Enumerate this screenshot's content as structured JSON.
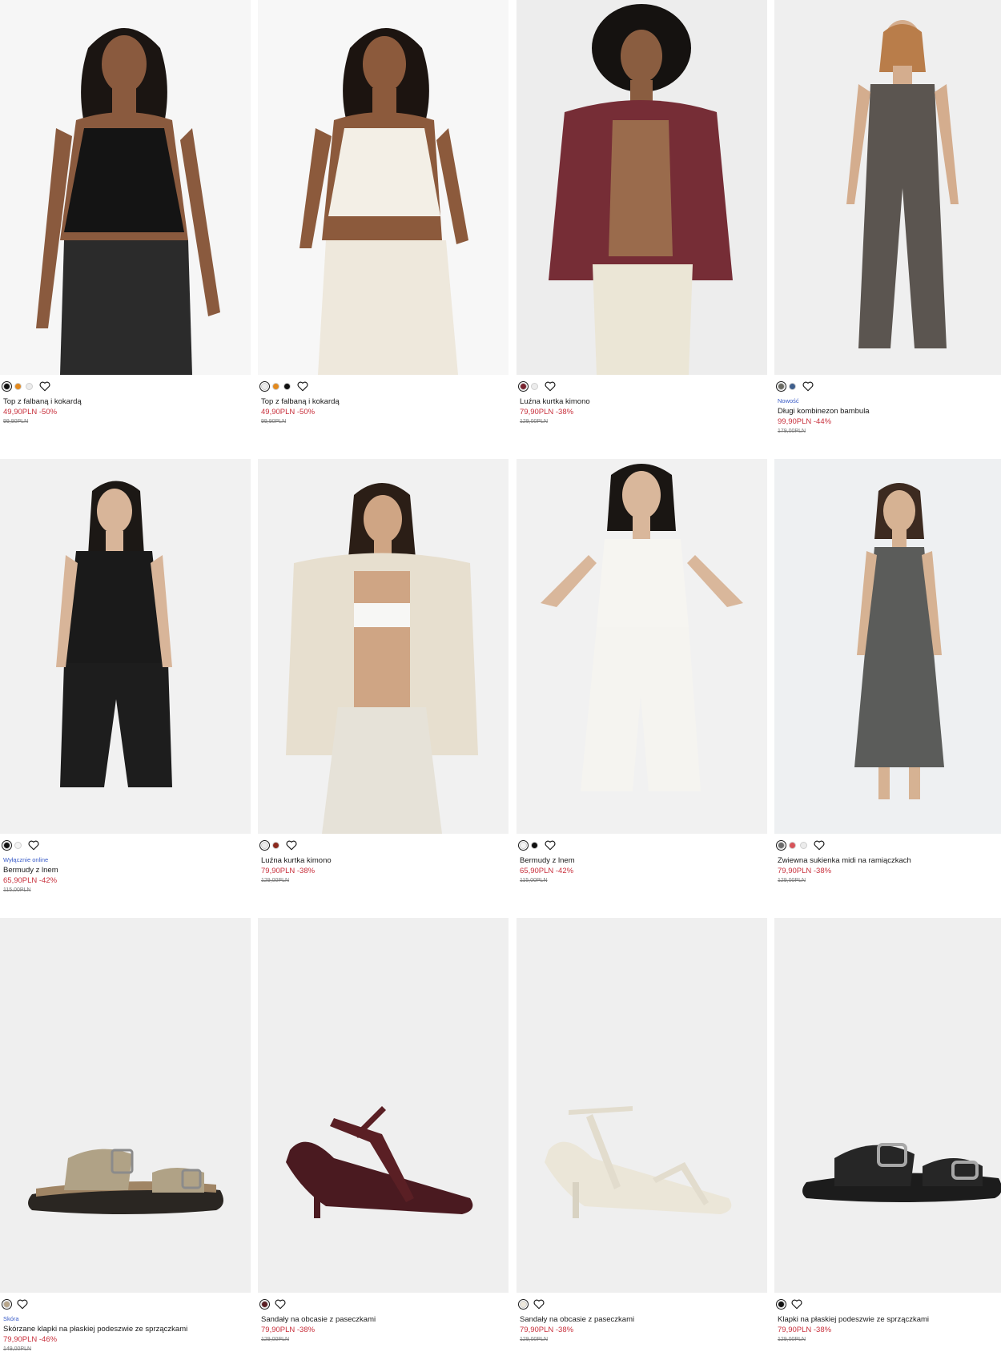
{
  "products": [
    {
      "name": "Top z falbaną i kokardą",
      "price": "49,90PLN -50%",
      "old_price": "99,90PLN",
      "tag": "",
      "swatches": [
        "#111111",
        "#e38a1e",
        "#ececec"
      ]
    },
    {
      "name": "Top z falbaną i kokardą",
      "price": "49,90PLN -50%",
      "old_price": "99,90PLN",
      "tag": "",
      "swatches": [
        "#ececec",
        "#e38a1e",
        "#111111"
      ]
    },
    {
      "name": "Luźna kurtka kimono",
      "price": "79,90PLN -38%",
      "old_price": "129,00PLN",
      "tag": "",
      "swatches": [
        "#7a2430",
        "#ececec"
      ]
    },
    {
      "name": "Długi kombinezon bambula",
      "price": "99,90PLN -44%",
      "old_price": "179,00PLN",
      "tag": "Nowość",
      "swatches": [
        "#6b6b63",
        "#3f5f8c"
      ]
    },
    {
      "name": "Bermudy z lnem",
      "price": "65,90PLN -42%",
      "old_price": "115,00PLN",
      "tag": "Wyłącznie online",
      "swatches": [
        "#111111",
        "#f4f4f4"
      ]
    },
    {
      "name": "Luźna kurtka kimono",
      "price": "79,90PLN -38%",
      "old_price": "129,00PLN",
      "tag": "",
      "swatches": [
        "#ececec",
        "#8b2a1e"
      ]
    },
    {
      "name": "Bermudy z lnem",
      "price": "65,90PLN -42%",
      "old_price": "115,00PLN",
      "tag": "",
      "swatches": [
        "#f4f4f4",
        "#111111"
      ]
    },
    {
      "name": "Zwiewna sukienka midi na ramiączkach",
      "price": "79,90PLN -38%",
      "old_price": "129,00PLN",
      "tag": "",
      "swatches": [
        "#6b6b6b",
        "#d8545a",
        "#ececec"
      ]
    },
    {
      "name": "Skórzane klapki na płaskiej podeszwie ze sprzączkami",
      "price": "79,90PLN -46%",
      "old_price": "149,00PLN",
      "tag": "Skóra",
      "swatches": [
        "#b7a58a"
      ]
    },
    {
      "name": "Sandały na obcasie z paseczkami",
      "price": "79,90PLN -38%",
      "old_price": "129,00PLN",
      "tag": "",
      "swatches": [
        "#5a1f24"
      ]
    },
    {
      "name": "Sandały na obcasie z paseczkami",
      "price": "79,90PLN -38%",
      "old_price": "129,00PLN",
      "tag": "",
      "swatches": [
        "#ede8dc"
      ]
    },
    {
      "name": "Klapki na płaskiej podeszwie ze sprzączkami",
      "price": "79,90PLN -38%",
      "old_price": "129,00PLN",
      "tag": "",
      "swatches": [
        "#111111"
      ]
    }
  ]
}
